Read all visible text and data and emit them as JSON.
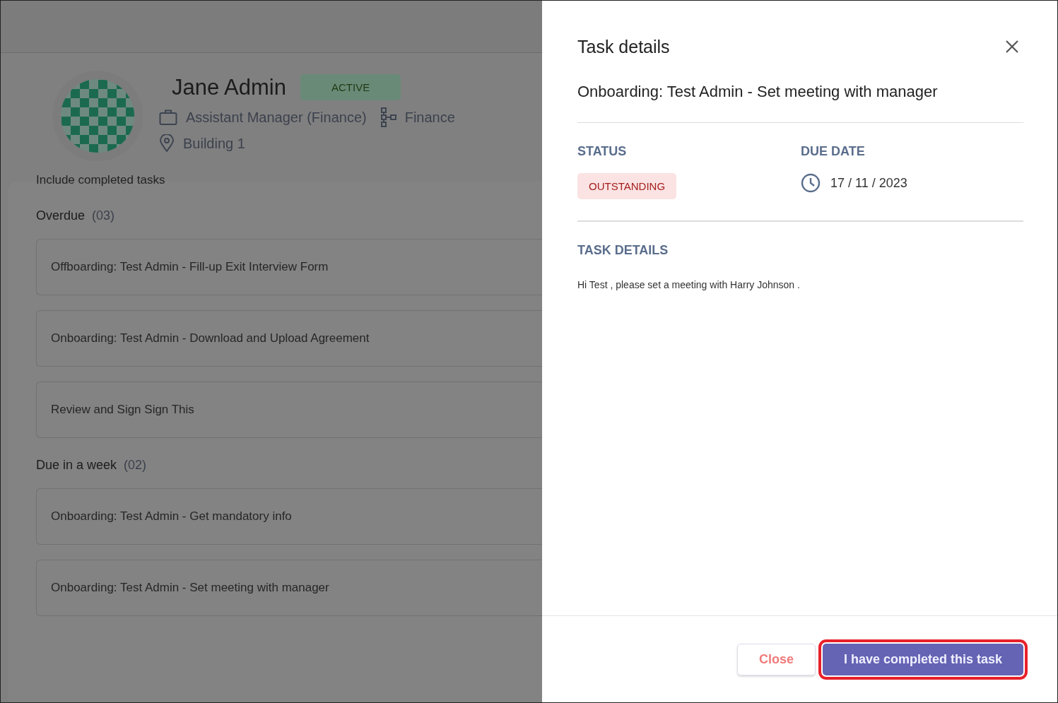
{
  "profile": {
    "name": "Jane Admin",
    "status": "ACTIVE",
    "role": "Assistant Manager (Finance)",
    "department": "Finance",
    "location": "Building 1"
  },
  "tasks_panel": {
    "filter_label": "Include completed tasks",
    "sections": [
      {
        "title": "Overdue",
        "count": "(03)",
        "tasks": [
          "Offboarding: Test Admin - Fill-up Exit Interview Form",
          "Onboarding: Test Admin - Download and Upload Agreement",
          "Review and Sign Sign This"
        ]
      },
      {
        "title": "Due in a week",
        "count": "(02)",
        "tasks": [
          "Onboarding: Test Admin - Get mandatory info",
          "Onboarding: Test Admin - Set meeting with manager"
        ]
      }
    ]
  },
  "drawer": {
    "title": "Task details",
    "task_title": "Onboarding: Test Admin - Set meeting with manager",
    "status_label": "STATUS",
    "status": "OUTSTANDING",
    "due_label": "DUE DATE",
    "due_date": "17 / 11 / 2023",
    "details_label": "TASK DETAILS",
    "details": "Hi Test , please set a meeting with Harry Johnson .",
    "buttons": [
      {
        "label": "Close",
        "kind": "secondary",
        "highlighted": false
      },
      {
        "label": "I have completed this task",
        "kind": "primary",
        "highlighted": true
      }
    ]
  }
}
